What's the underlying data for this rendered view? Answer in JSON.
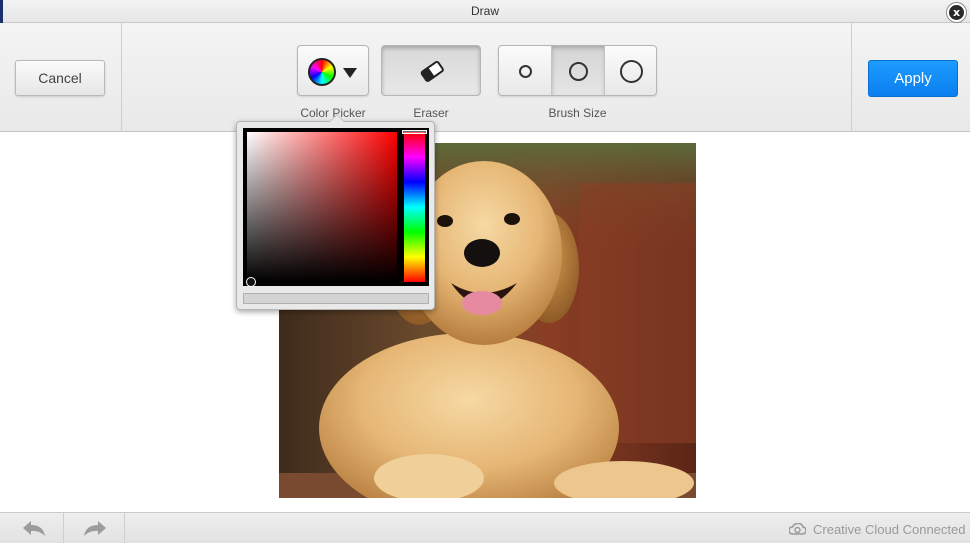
{
  "window": {
    "title": "Draw",
    "close_label": "x"
  },
  "toolbar": {
    "cancel_label": "Cancel",
    "apply_label": "Apply",
    "color_picker_label": "Color Picker",
    "eraser_label": "Eraser",
    "brush_size_label": "Brush Size",
    "brush_sizes": [
      "small",
      "medium",
      "large"
    ],
    "selected_brush_size": "medium"
  },
  "color_picker": {
    "selected_hue": "#ff0000",
    "selected_color": "#000000"
  },
  "canvas": {
    "image_subject": "golden retriever puppy photo"
  },
  "bottombar": {
    "undo_icon": "undo-arrow-icon",
    "redo_icon": "redo-arrow-icon",
    "status_text": "Creative Cloud Connected"
  },
  "colors": {
    "accent": "#0b7ef0",
    "titlebar_edge": "#1a2f6b"
  }
}
